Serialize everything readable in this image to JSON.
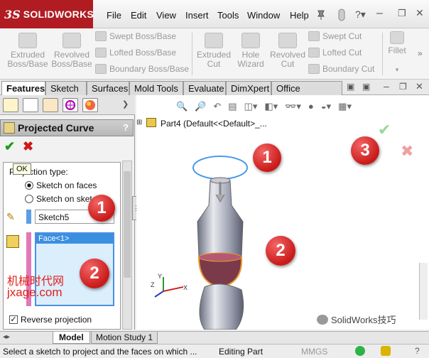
{
  "app": {
    "brand_prefix": "3S",
    "brand": "SOLIDWORKS"
  },
  "menu": [
    "File",
    "Edit",
    "View",
    "Insert",
    "Tools",
    "Window",
    "Help"
  ],
  "ribbon": {
    "extruded_boss": "Extruded\nBoss/Base",
    "revolved_boss": "Revolved\nBoss/Base",
    "swept_boss": "Swept Boss/Base",
    "lofted_boss": "Lofted Boss/Base",
    "boundary_boss": "Boundary Boss/Base",
    "extruded_cut": "Extruded\nCut",
    "hole_wizard": "Hole\nWizard",
    "revolved_cut": "Revolved\nCut",
    "swept_cut": "Swept Cut",
    "lofted_cut": "Lofted Cut",
    "boundary_cut": "Boundary Cut",
    "fillet": "Fillet"
  },
  "tabs": [
    "Features",
    "Sketch",
    "Surfaces",
    "Mold Tools",
    "Evaluate",
    "DimXpert",
    "Office Products"
  ],
  "property_manager": {
    "title": "Projected Curve",
    "help": "?",
    "ok_tooltip": "OK",
    "projection_type_label": "Projection type:",
    "option_faces": "Sketch on faces",
    "option_sketch": "Sketch on sketch",
    "sketch_value": "Sketch5",
    "face_item": "Face<1>",
    "reverse_label": "Reverse projection"
  },
  "tree": {
    "part": "Part4 (Default<<Default>_..."
  },
  "callouts": [
    "1",
    "2",
    "3"
  ],
  "watermark": {
    "cn": "机械时代网",
    "url": "jxage.com"
  },
  "wechat": "SolidWorks技巧",
  "axes": {
    "y": "Y",
    "z": "Z",
    "x": "X"
  },
  "bottom_tabs": [
    "Model",
    "Motion Study 1"
  ],
  "status": {
    "hint": "Select a sketch to project and the faces on which ...",
    "mode": "Editing Part",
    "units": "MMGS"
  }
}
